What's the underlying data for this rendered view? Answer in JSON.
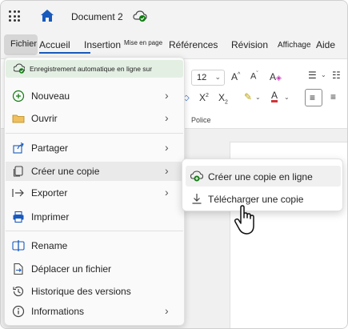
{
  "titlebar": {
    "doc_title": "Document 2"
  },
  "ribbon_tabs": {
    "fichier": "Fichier",
    "accueil": "Accueil",
    "insertion": "Insertion",
    "mise_en_page": "Mise en page",
    "references": "Références",
    "revision": "Révision",
    "affichage": "Affichage",
    "aide": "Aide"
  },
  "ribbon": {
    "font_size": "12",
    "group_label": "Police"
  },
  "file_menu": {
    "autosave_text": "Enregistrement automatique en ligne sur",
    "items": [
      {
        "label": "Nouveau",
        "icon": "plus-circle-icon"
      },
      {
        "label": "Ouvrir",
        "icon": "folder-icon"
      },
      {
        "label": "Partager",
        "icon": "share-icon"
      },
      {
        "label": "Créer une copie",
        "icon": "copy-icon"
      },
      {
        "label": "Exporter",
        "icon": "export-icon"
      },
      {
        "label": "Imprimer",
        "icon": "printer-icon"
      },
      {
        "label": "Rename",
        "icon": "rename-icon"
      },
      {
        "label": "Déplacer un fichier",
        "icon": "move-file-icon"
      },
      {
        "label": "Historique des versions",
        "icon": "history-icon"
      },
      {
        "label": "Informations",
        "icon": "info-icon"
      }
    ]
  },
  "submenu": {
    "items": [
      {
        "label": "Créer une copie en ligne",
        "icon": "cloud-copy-icon"
      },
      {
        "label": "Télécharger une copie",
        "icon": "download-icon"
      }
    ]
  },
  "colors": {
    "accent": "#185abd",
    "saved_green": "#107c10",
    "font_color_red": "#d13438"
  }
}
